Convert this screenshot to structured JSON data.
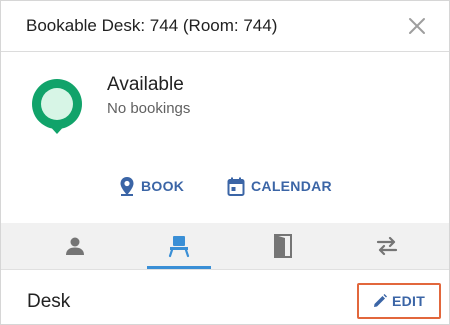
{
  "dialog": {
    "title": "Bookable Desk: 744 (Room: 744)"
  },
  "status": {
    "label": "Available",
    "sub": "No bookings",
    "color": "#11a36a"
  },
  "actions": {
    "book_label": "BOOK",
    "calendar_label": "CALENDAR"
  },
  "tabs": [
    {
      "icon": "person-icon",
      "active": false
    },
    {
      "icon": "desk-chair-icon",
      "active": true
    },
    {
      "icon": "door-icon",
      "active": false
    },
    {
      "icon": "swap-arrows-icon",
      "active": false
    }
  ],
  "section": {
    "title": "Desk",
    "edit_label": "EDIT"
  },
  "colors": {
    "accent": "#3b65a6",
    "tab_indicator": "#3a8fd6",
    "highlight_border": "#e2673c"
  }
}
